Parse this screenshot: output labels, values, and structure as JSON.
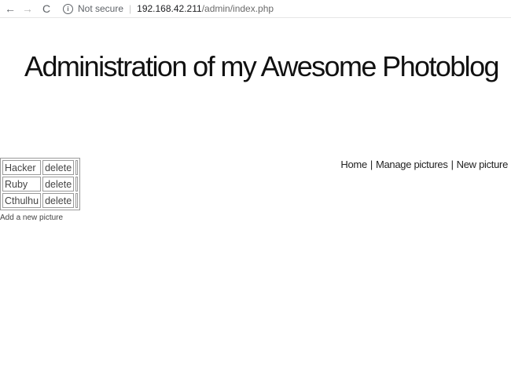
{
  "browser": {
    "back_icon": "←",
    "forward_icon": "→",
    "reload_icon": "C",
    "info_icon": "i",
    "security_label": "Not secure",
    "divider": "|",
    "url_host": "192.168.42.211",
    "url_path": "/admin/index.php"
  },
  "page": {
    "title": "Administration of my Awesome Photoblog"
  },
  "nav": {
    "home": "Home",
    "manage": "Manage pictures",
    "new": "New picture",
    "separator": "|"
  },
  "pictures": {
    "rows": [
      {
        "name": "Hacker",
        "action": "delete"
      },
      {
        "name": "Ruby",
        "action": "delete"
      },
      {
        "name": "Cthulhu",
        "action": "delete"
      }
    ]
  },
  "add_link": "Add a new picture"
}
